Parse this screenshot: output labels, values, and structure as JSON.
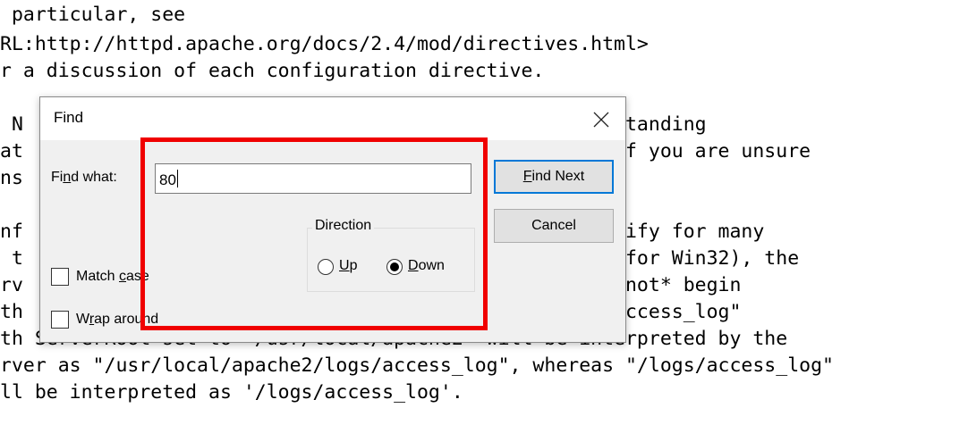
{
  "background": {
    "lines": [
      " particular, see",
      "RL:http://httpd.apache.org/docs/2.4/mod/directives.html>",
      "r a discussion of each configuration directive.",
      "",
      " N                                          but understanding",
      "at                                          inders.  If you are unsure",
      "ns",
      "",
      "nf                                          s you specify for many",
      " t                                          \"drive:/\" for Win32), the",
      "rv                                          names do *not* begin",
      "th                                        - so \"logs/access_log\"",
      "th ServerRoot set to \"/usr/local/apache2\" will be interpreted by the",
      "rver as \"/usr/local/apache2/logs/access_log\", whereas \"/logs/access_log\"",
      "ll be interpreted as '/logs/access_log'."
    ]
  },
  "dialog": {
    "title": "Find",
    "close_icon": "close-icon",
    "find_what_label_pre": "Fi",
    "find_what_label_key": "n",
    "find_what_label_post": "d what:",
    "find_value": "80",
    "find_next_key": "F",
    "find_next_rest": "ind Next",
    "cancel_label": "Cancel",
    "direction_label": "Direction",
    "up_key": "U",
    "up_rest": "p",
    "down_key": "D",
    "down_rest": "own",
    "direction_selected": "Down",
    "match_case_pre": "Match ",
    "match_case_key": "c",
    "match_case_post": "ase",
    "match_case_checked": false,
    "wrap_pre": "W",
    "wrap_key": "r",
    "wrap_post": "ap around",
    "wrap_checked": false
  },
  "annotation": {
    "color": "#f00000"
  }
}
